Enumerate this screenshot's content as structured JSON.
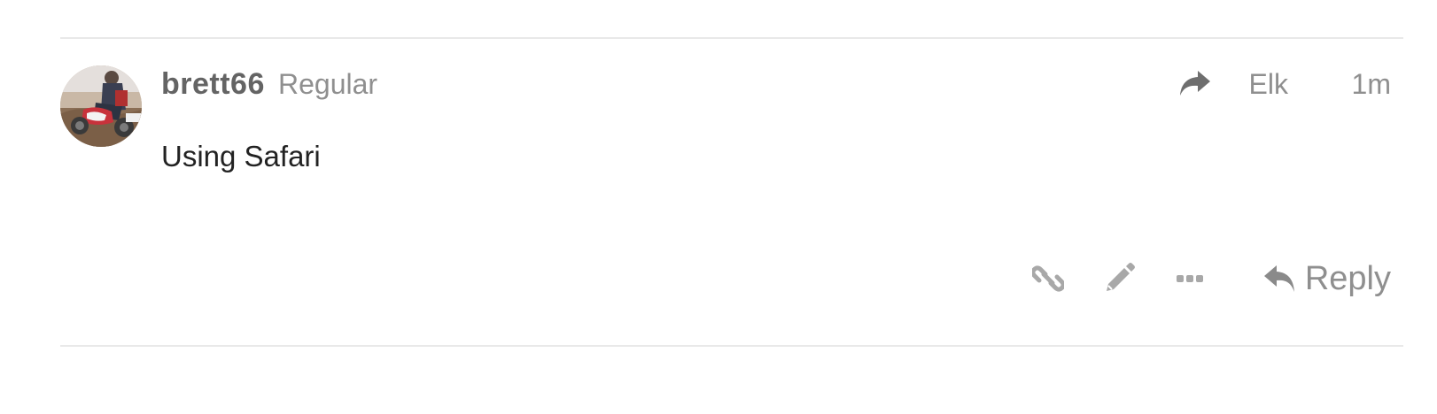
{
  "post": {
    "username": "brett66",
    "user_title": "Regular",
    "reply_to_user": "Elk",
    "date": "1m",
    "body": "Using Safari"
  },
  "actions": {
    "copy_link_icon": "link-icon",
    "edit_icon": "pencil-icon",
    "more_icon": "ellipsis-icon",
    "reply_icon": "reply-icon",
    "reply_label": "Reply"
  },
  "colors": {
    "muted_text": "#8f8f8f",
    "username": "#646464",
    "body_text": "#222222",
    "icon": "#9e9e9e",
    "divider": "#e9e9e9"
  }
}
